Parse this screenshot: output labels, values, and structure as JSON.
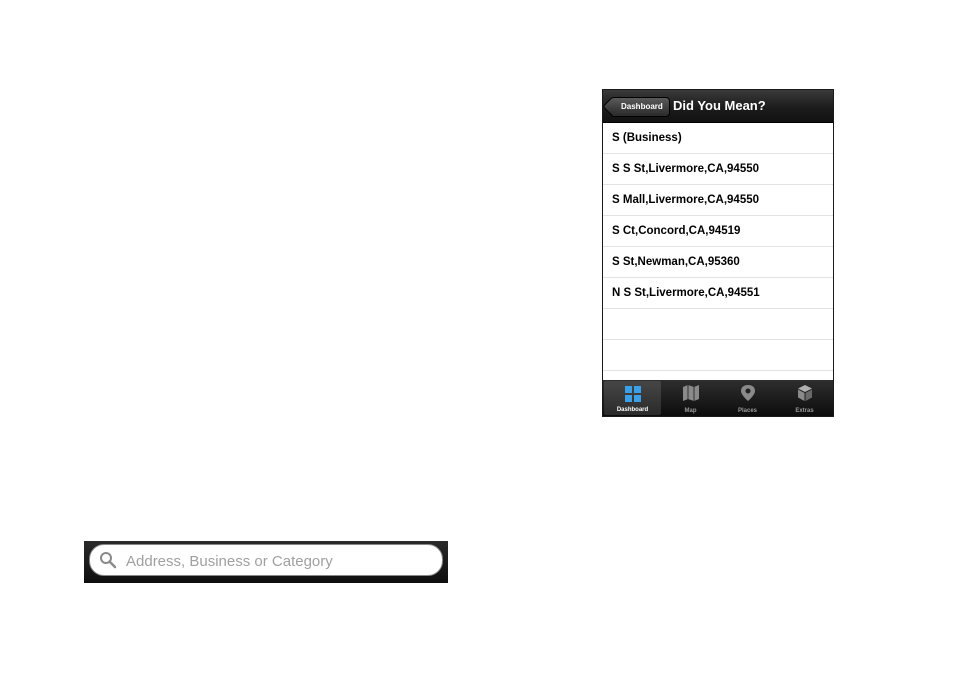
{
  "navbar": {
    "back_label": "Dashboard",
    "title": "Did You Mean?"
  },
  "suggestions": [
    "S (Business)",
    "S S St,Livermore,CA,94550",
    "S Mall,Livermore,CA,94550",
    "S Ct,Concord,CA,94519",
    "S St,Newman,CA,95360",
    "N S St,Livermore,CA,94551",
    "",
    ""
  ],
  "tabbar": {
    "tabs": [
      {
        "label": "Dashboard",
        "icon": "dashboard-icon",
        "active": true
      },
      {
        "label": "Map",
        "icon": "map-icon",
        "active": false
      },
      {
        "label": "Places",
        "icon": "places-pin-icon",
        "active": false
      },
      {
        "label": "Extras",
        "icon": "extras-box-icon",
        "active": false
      }
    ]
  },
  "search": {
    "placeholder": "Address, Business or Category",
    "value": "",
    "icon": "search-icon"
  },
  "colors": {
    "bar_dark": "#1c1c1c",
    "active_tab_blue": "#3aa0e8",
    "row_divider": "#e3e3e3"
  }
}
